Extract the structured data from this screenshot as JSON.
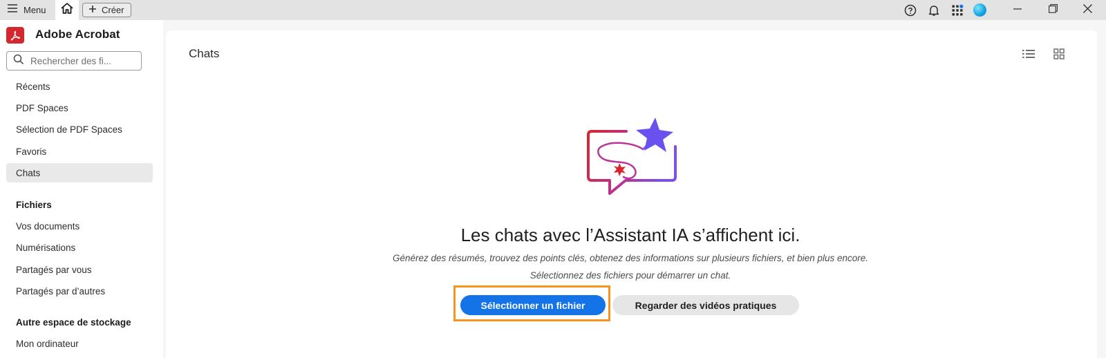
{
  "titlebar": {
    "menu_label": "Menu",
    "create_label": "Créer",
    "icons": [
      "menu-icon",
      "home-icon",
      "plus-icon",
      "help-icon",
      "bell-icon",
      "apps-grid-icon",
      "avatar",
      "minimize-icon",
      "restore-icon",
      "close-icon"
    ]
  },
  "app": {
    "title": "Adobe Acrobat",
    "logo_icon": "acrobat-logo-icon",
    "brand_color": "#d7272e"
  },
  "search": {
    "placeholder": "Rechercher des fi..."
  },
  "sidebar": {
    "items": [
      {
        "label": "Récents"
      },
      {
        "label": "PDF Spaces"
      },
      {
        "label": "Sélection de PDF Spaces"
      },
      {
        "label": "Favoris"
      },
      {
        "label": "Chats",
        "active": true
      }
    ],
    "files_heading": "Fichiers",
    "files_items": [
      {
        "label": "Vos documents"
      },
      {
        "label": "Numérisations"
      },
      {
        "label": "Partagés par vous"
      },
      {
        "label": "Partagés par d’autres"
      }
    ],
    "storage_heading": "Autre espace de stockage",
    "storage_items": [
      {
        "label": "Mon ordinateur"
      }
    ]
  },
  "main": {
    "title": "Chats",
    "view_icons": [
      "list-view-icon",
      "grid-view-icon"
    ],
    "empty_state": {
      "heading": "Les chats avec l’Assistant IA s’affichent ici.",
      "line1": "Générez des résumés, trouvez des points clés, obtenez des informations sur plusieurs fichiers, et bien plus encore.",
      "line2": "Sélectionnez des fichiers pour démarrer un chat.",
      "primary_button": "Sélectionner un fichier",
      "secondary_button": "Regarder des vidéos pratiques"
    }
  },
  "colors": {
    "accent": "#1473e6",
    "highlight": "#f7941d",
    "star": "#6b50f0"
  }
}
